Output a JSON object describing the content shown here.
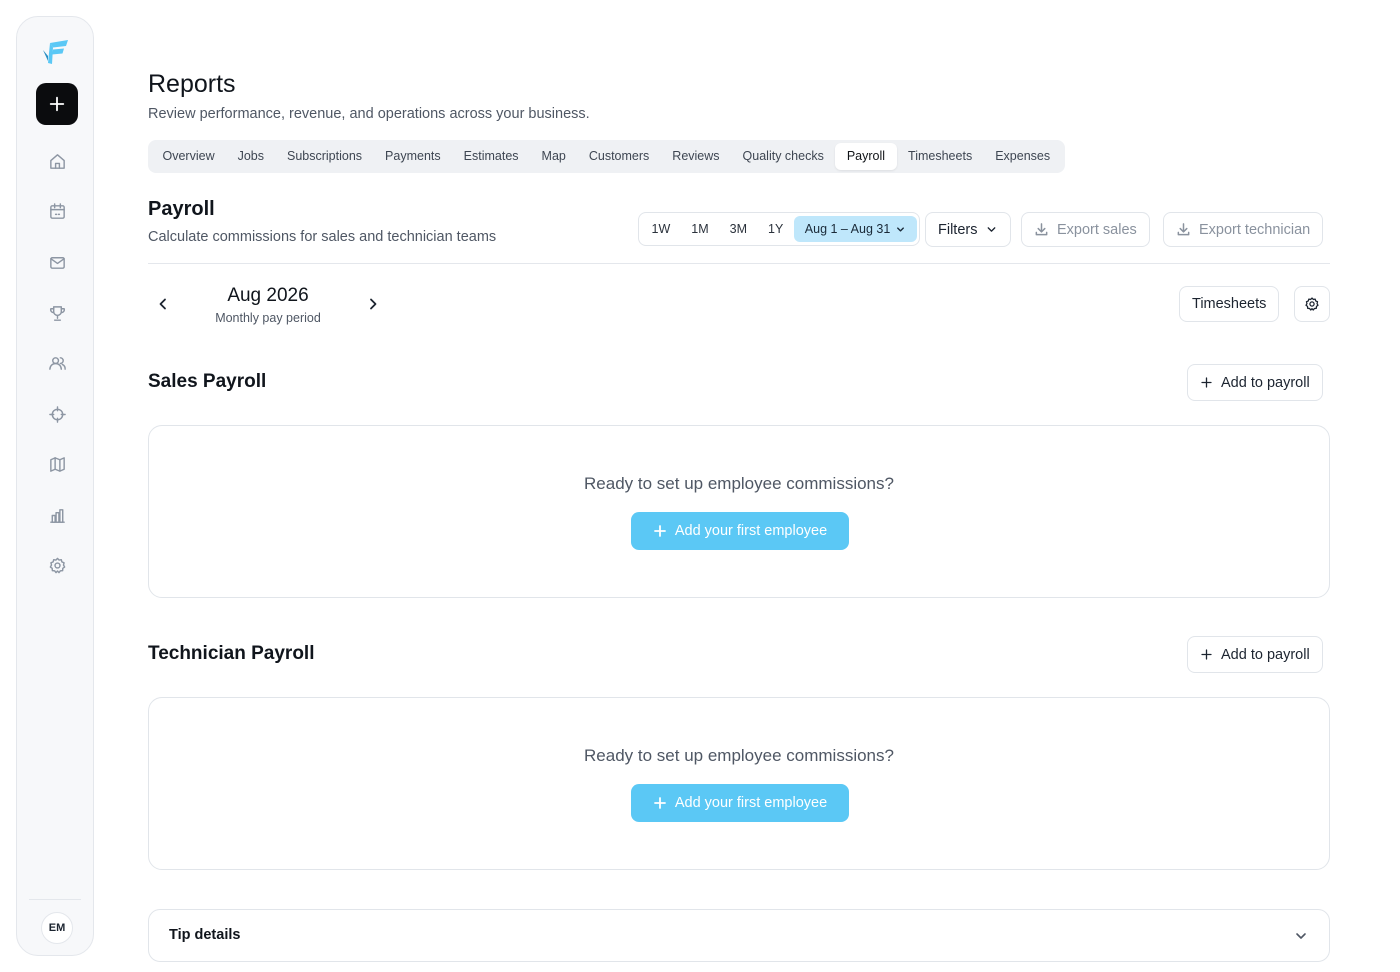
{
  "sidebar": {
    "logo_icon": "brand-logo-icon",
    "new_icon": "plus-icon",
    "nav": [
      {
        "icon": "home-icon"
      },
      {
        "icon": "calendar-icon"
      },
      {
        "icon": "mail-icon"
      },
      {
        "icon": "trophy-icon"
      },
      {
        "icon": "users-icon"
      },
      {
        "icon": "target-icon"
      },
      {
        "icon": "map-icon"
      },
      {
        "icon": "bar-chart-icon"
      },
      {
        "icon": "settings-icon"
      }
    ],
    "avatar_initials": "EM"
  },
  "header": {
    "title": "Reports",
    "subtitle": "Review performance, revenue, and operations across your business."
  },
  "tabs": [
    {
      "label": "Overview"
    },
    {
      "label": "Jobs"
    },
    {
      "label": "Subscriptions"
    },
    {
      "label": "Payments"
    },
    {
      "label": "Estimates"
    },
    {
      "label": "Map"
    },
    {
      "label": "Customers"
    },
    {
      "label": "Reviews"
    },
    {
      "label": "Quality checks"
    },
    {
      "label": "Payroll",
      "active": true
    },
    {
      "label": "Timesheets"
    },
    {
      "label": "Expenses"
    }
  ],
  "section": {
    "title": "Payroll",
    "subtitle": "Calculate commissions for sales and technician teams"
  },
  "range": {
    "options": [
      "1W",
      "1M",
      "3M",
      "1Y"
    ],
    "selected": "Aug 1 – Aug 31"
  },
  "toolbar": {
    "filters_label": "Filters",
    "export_sales_label": "Export sales",
    "export_technician_label": "Export technician",
    "timesheets_label": "Timesheets"
  },
  "period": {
    "title": "Aug 2026",
    "subtitle": "Monthly pay period"
  },
  "sales_payroll": {
    "title": "Sales Payroll",
    "add_label": "Add to payroll",
    "empty_message": "Ready to set up employee commissions?",
    "cta_label": "Add your first employee"
  },
  "technician_payroll": {
    "title": "Technician Payroll",
    "add_label": "Add to payroll",
    "empty_message": "Ready to set up employee commissions?",
    "cta_label": "Add your first employee"
  },
  "tip_details": {
    "label": "Tip details"
  },
  "colors": {
    "accent": "#5bc8f5",
    "accent_light": "#bfe7fb",
    "primary_dark": "#0b0c0e"
  }
}
